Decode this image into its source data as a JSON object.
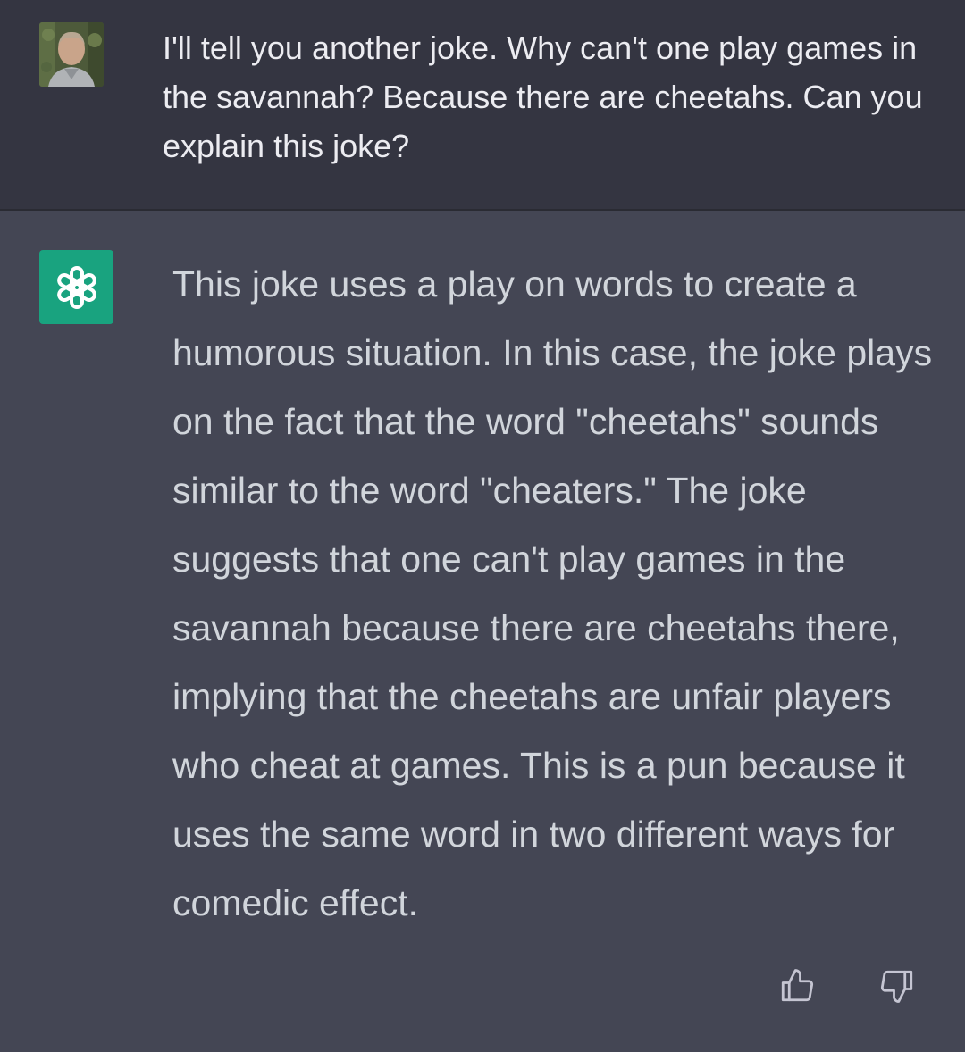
{
  "user_message": {
    "text": "I'll tell you another joke. Why can't one play games in the savannah? Because there are cheetahs. Can you explain this joke?",
    "avatar": "user-photo-avatar"
  },
  "assistant_message": {
    "text": "This joke uses a play on words to create a humorous situation. In this case, the joke plays on the fact that the word \"cheetahs\" sounds similar to the word \"cheaters.\" The joke suggests that one can't play games in the savannah because there are cheetahs there, implying that the cheetahs are unfair players who cheat at games. This is a pun because it uses the same word in two different ways for comedic effect.",
    "avatar": "chatgpt-logo-icon"
  },
  "actions": {
    "thumbs_up_icon": "thumbs-up-icon",
    "thumbs_down_icon": "thumbs-down-icon"
  },
  "colors": {
    "user_bg": "#343541",
    "assistant_bg": "#444654",
    "logo_bg": "#19a37f",
    "text": "#d1d5db"
  }
}
